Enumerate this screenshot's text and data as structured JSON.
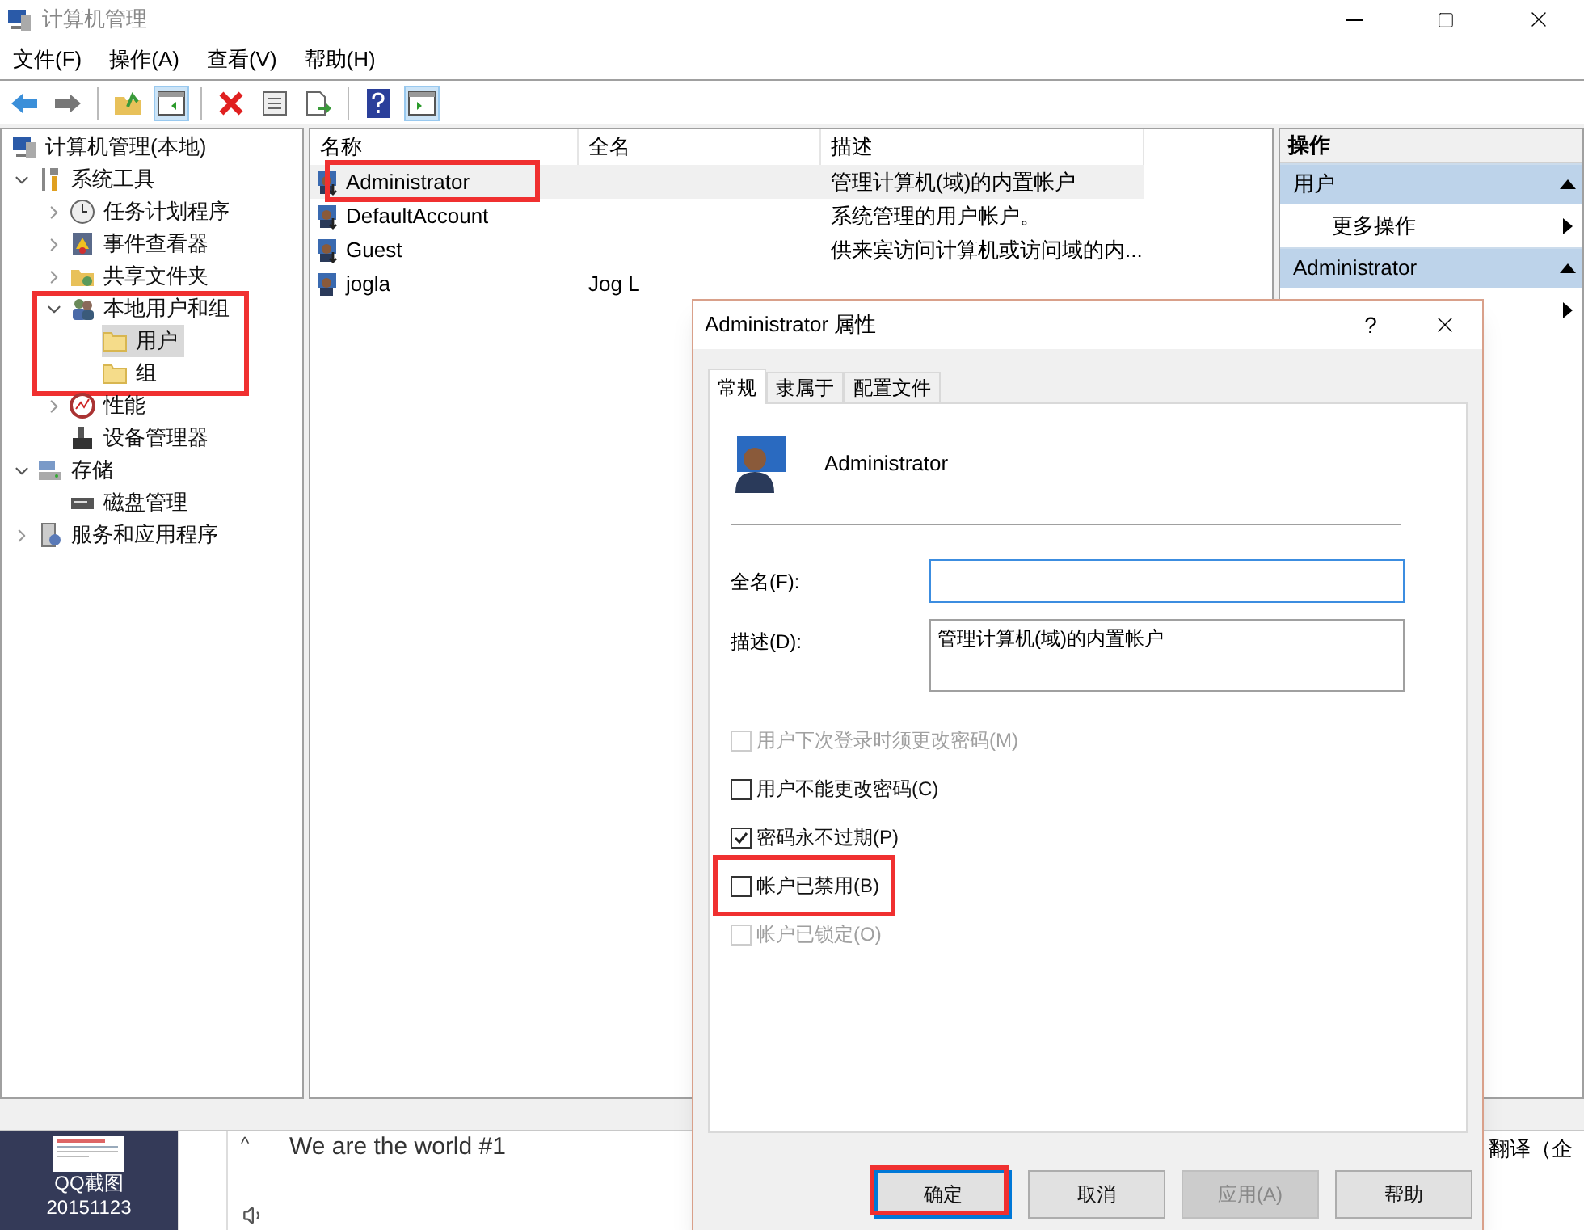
{
  "window": {
    "title": "计算机管理"
  },
  "menu": [
    "文件(F)",
    "操作(A)",
    "查看(V)",
    "帮助(H)"
  ],
  "toolbar": [
    {
      "kind": "back",
      "active": false
    },
    {
      "kind": "forward",
      "active": false
    },
    {
      "kind": "sep"
    },
    {
      "kind": "up",
      "active": false
    },
    {
      "kind": "tree",
      "active": true
    },
    {
      "kind": "sep"
    },
    {
      "kind": "delete",
      "active": false
    },
    {
      "kind": "properties",
      "active": false
    },
    {
      "kind": "export",
      "active": false
    },
    {
      "kind": "sep"
    },
    {
      "kind": "help",
      "active": false
    },
    {
      "kind": "actionpane",
      "active": true
    }
  ],
  "tree": [
    {
      "label": "计算机管理(本地)",
      "kind": "computer",
      "selected": false,
      "children": [
        {
          "label": "系统工具",
          "kind": "tools",
          "expanded": true,
          "selected": false,
          "children": [
            {
              "label": "任务计划程序",
              "kind": "clock",
              "expanded": false,
              "selected": false
            },
            {
              "label": "事件查看器",
              "kind": "log",
              "expanded": false,
              "selected": false
            },
            {
              "label": "共享文件夹",
              "kind": "share",
              "expanded": false,
              "selected": false
            },
            {
              "label": "本地用户和组",
              "kind": "users",
              "expanded": true,
              "selected": false,
              "highlighted": true,
              "children": [
                {
                  "label": "用户",
                  "kind": "folder",
                  "selected": true
                },
                {
                  "label": "组",
                  "kind": "folder",
                  "selected": false
                }
              ]
            },
            {
              "label": "性能",
              "kind": "perf",
              "expanded": false,
              "selected": false
            },
            {
              "label": "设备管理器",
              "kind": "device",
              "selected": false
            }
          ]
        },
        {
          "label": "存储",
          "kind": "storage",
          "expanded": true,
          "selected": false,
          "children": [
            {
              "label": "磁盘管理",
              "kind": "disk",
              "selected": false
            }
          ]
        },
        {
          "label": "服务和应用程序",
          "kind": "services",
          "expanded": false,
          "selected": false
        }
      ]
    }
  ],
  "list": {
    "columns": [
      "名称",
      "全名",
      "描述"
    ],
    "rows": [
      {
        "name": "Administrator",
        "description": "管理计算机(域)的内置帐户",
        "disabled_account": true,
        "selected": true,
        "highlighted": true
      },
      {
        "name": "DefaultAccount",
        "description": "系统管理的用户帐户。",
        "disabled_account": true,
        "selected": false,
        "highlighted": false
      },
      {
        "name": "Guest",
        "description": "供来宾访问计算机或访问域的内...",
        "disabled_account": true,
        "selected": false,
        "highlighted": false
      },
      {
        "name": "jogla",
        "full_name": "Jog L",
        "disabled_account": false,
        "selected": false,
        "highlighted": false
      }
    ]
  },
  "actions": {
    "title": "操作",
    "sections": [
      {
        "title": "用户",
        "items": [
          {
            "kind": "submenu",
            "label": "更多操作"
          }
        ]
      },
      {
        "title": "Administrator",
        "items": [
          {
            "kind": "submenu"
          }
        ]
      }
    ]
  },
  "dialog": {
    "title": "Administrator 属性",
    "help": "?",
    "tabs": [
      {
        "label": "常规",
        "selected": true
      },
      {
        "label": "隶属于",
        "selected": false
      },
      {
        "label": "配置文件",
        "selected": false
      }
    ],
    "user_name": "Administrator",
    "fields": [
      {
        "label": "全名(F):",
        "kind": "input"
      },
      {
        "label": "描述(D):",
        "value": "管理计算机(域)的内置帐户",
        "kind": "textarea"
      }
    ],
    "options": [
      {
        "label": "用户下次登录时须更改密码(M)",
        "checked": false,
        "disabled": true,
        "highlighted": false
      },
      {
        "label": "用户不能更改密码(C)",
        "checked": false,
        "disabled": false,
        "highlighted": false
      },
      {
        "label": "密码永不过期(P)",
        "checked": true,
        "disabled": false,
        "highlighted": false
      },
      {
        "label": "帐户已禁用(B)",
        "checked": false,
        "disabled": false,
        "highlighted": true
      },
      {
        "label": "帐户已锁定(O)",
        "checked": false,
        "disabled": true,
        "highlighted": false
      }
    ],
    "buttons": [
      {
        "label": "确定",
        "default": true,
        "disabled": false,
        "highlighted": true
      },
      {
        "label": "取消",
        "default": false,
        "disabled": false,
        "highlighted": false
      },
      {
        "label": "应用(A)",
        "default": false,
        "disabled": true,
        "highlighted": false
      },
      {
        "label": "帮助",
        "default": false,
        "disabled": false,
        "highlighted": false
      }
    ]
  },
  "desktop_icon": {
    "lines": [
      "QQ截图",
      "20151123"
    ]
  },
  "background_window": {
    "caret": "^",
    "heading": "We are the world #1",
    "right_text": "翻译（企"
  }
}
